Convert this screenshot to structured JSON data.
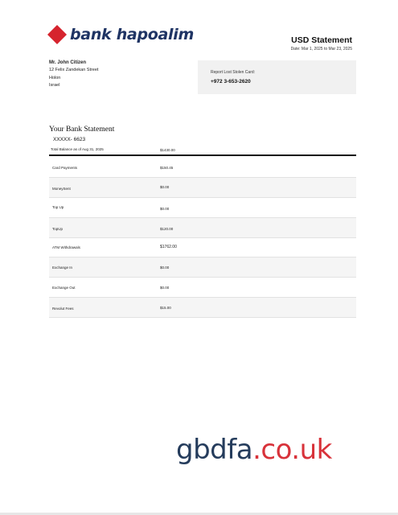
{
  "brand": {
    "name": "bank hapoalim",
    "logo_color": "#d6242e",
    "text_color": "#1f3464"
  },
  "statement": {
    "title": "USD Statement",
    "dates": "Date: Mar 1, 2025 to Mar 23, 2025"
  },
  "customer": {
    "name": "Mr. John Citizen",
    "address_line1": "12 Felix Zandekan Street",
    "city": "Holon",
    "country": "Israel"
  },
  "lost_card": {
    "label": "Report Lost Stolen Card:",
    "phone": "+972 3-653-2620"
  },
  "summary": {
    "section_title": "Your Bank Statement",
    "account_number": "XXXXX- 6623",
    "balance_label": "Total Balance as of Aug 31, 2025",
    "balance_value": "$1430.00"
  },
  "transactions": [
    {
      "label": "Card Payments",
      "value": "$150.45"
    },
    {
      "label": "MoneySent",
      "value": "$0.00"
    },
    {
      "label": "Top Up",
      "value": "$0.00"
    },
    {
      "label": "TopUp",
      "value": "$120.00"
    },
    {
      "label": "ATM Withdrawals",
      "value": "$1762.00"
    },
    {
      "label": "Exchange In",
      "value": "$0.00"
    },
    {
      "label": "Exchange Out",
      "value": "$0.00"
    },
    {
      "label": "Revolut Fees",
      "value": "$15.00"
    }
  ],
  "watermark": {
    "part1": "gbdfa",
    "part2": ".co.uk",
    "color1": "#253c5c",
    "color2": "#d8323a"
  }
}
